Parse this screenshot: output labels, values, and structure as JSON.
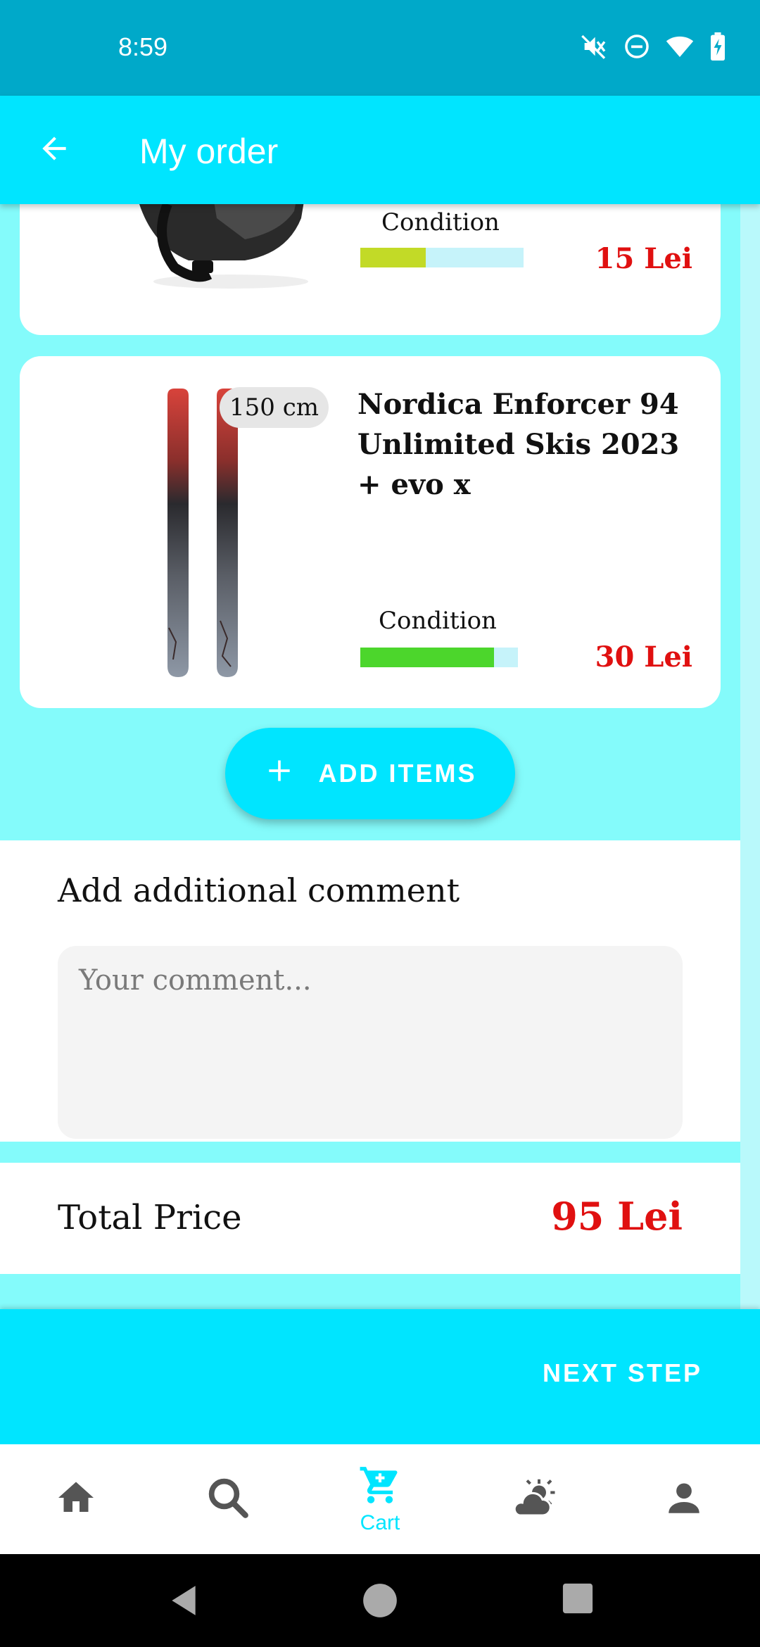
{
  "status_bar": {
    "time": "8:59",
    "icons": [
      "mute-icon",
      "dnd-icon",
      "wifi-icon",
      "battery-charging-icon"
    ]
  },
  "app_bar": {
    "title": "My order",
    "back_icon": "arrow-left-icon"
  },
  "order_items": [
    {
      "image": "ski-helmet",
      "condition_label": "Condition",
      "condition_level": 0.4,
      "condition_color": "#C2DA27",
      "price": "15 Lei"
    },
    {
      "image": "skis",
      "size": "150 cm",
      "title": "Nordica Enforcer 94 Unlimited Skis 2023 + evo x",
      "condition_label": "Condition",
      "condition_level": 0.85,
      "condition_color": "#4CD62C",
      "price": "30 Lei"
    }
  ],
  "add_items": {
    "label": "ADD ITEMS",
    "icon": "plus-icon"
  },
  "comment": {
    "heading": "Add additional comment",
    "placeholder": "Your comment...",
    "value": ""
  },
  "total": {
    "label": "Total Price",
    "value": "95 Lei"
  },
  "next_step": {
    "label": "NEXT STEP"
  },
  "bottom_nav": {
    "items": [
      {
        "icon": "home-icon",
        "label": "",
        "active": false
      },
      {
        "icon": "search-icon",
        "label": "",
        "active": false
      },
      {
        "icon": "cart-icon",
        "label": "Cart",
        "active": true
      },
      {
        "icon": "weather-icon",
        "label": "",
        "active": false
      },
      {
        "icon": "profile-icon",
        "label": "",
        "active": false
      }
    ]
  },
  "colors": {
    "accent": "#00E5FF",
    "status_bar": "#00A9C9",
    "background": "#84FBFB",
    "price": "#E01010"
  }
}
